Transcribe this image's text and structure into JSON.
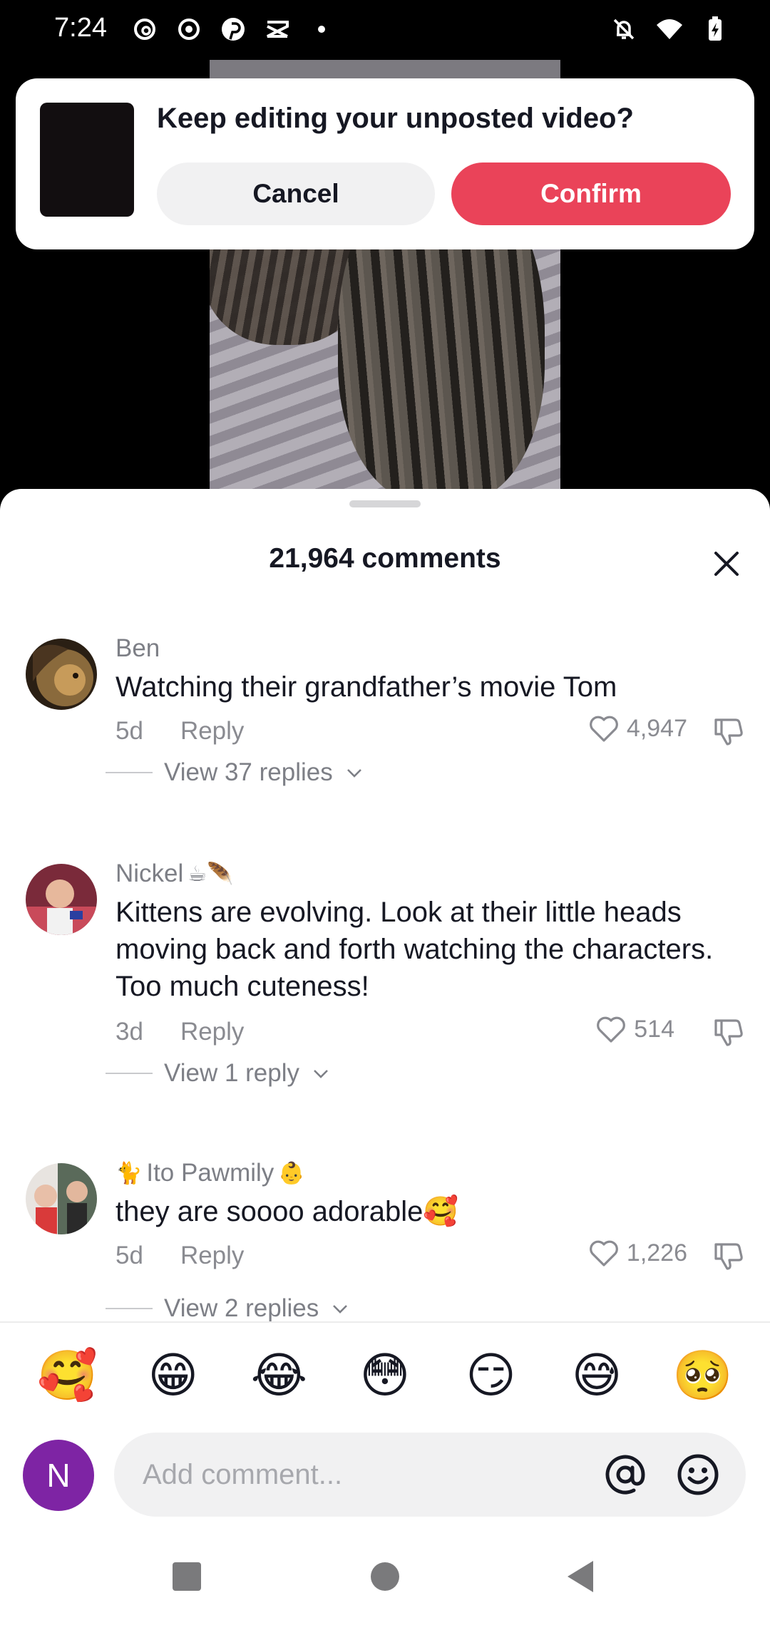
{
  "status_bar": {
    "time": "7:24",
    "left_icons": [
      "threads-icon",
      "record-icon",
      "pinterest-icon",
      "capcut-icon",
      "dot-icon"
    ],
    "right_icons": [
      "bell-off-icon",
      "wifi-icon",
      "battery-charging-icon"
    ]
  },
  "dialog": {
    "title": "Keep editing your unposted video?",
    "cancel_label": "Cancel",
    "confirm_label": "Confirm",
    "confirm_color": "#ea4359"
  },
  "comments_sheet": {
    "title": "21,964 comments",
    "comments": [
      {
        "author": "Ben",
        "text": "Watching their grandfather’s movie Tom",
        "age": "5d",
        "reply_label": "Reply",
        "likes": "4,947",
        "view_replies": "View 37 replies"
      },
      {
        "author": "Nickel",
        "author_emojis": "☕🪶",
        "text": "Kittens are evolving. Look at their little heads moving back and forth watching the characters. Too much cuteness!",
        "age": "3d",
        "reply_label": "Reply",
        "likes": "514",
        "view_replies": "View 1 reply"
      },
      {
        "author": "Ito Pawmily",
        "author_prefix_emoji": "🐈",
        "author_suffix_emoji": "👶",
        "text": "they are soooo adorable🥰",
        "age": "5d",
        "reply_label": "Reply",
        "likes": "1,226",
        "view_replies": "View 2 replies"
      }
    ],
    "quick_emojis": [
      "🥰",
      "😁",
      "😂",
      "😳",
      "😏",
      "😅",
      "🥺"
    ],
    "input": {
      "avatar_letter": "N",
      "avatar_color": "#7e24a4",
      "placeholder": "Add comment..."
    }
  },
  "nav_bar": {
    "buttons": [
      "recents-icon",
      "home-icon",
      "back-icon"
    ]
  }
}
